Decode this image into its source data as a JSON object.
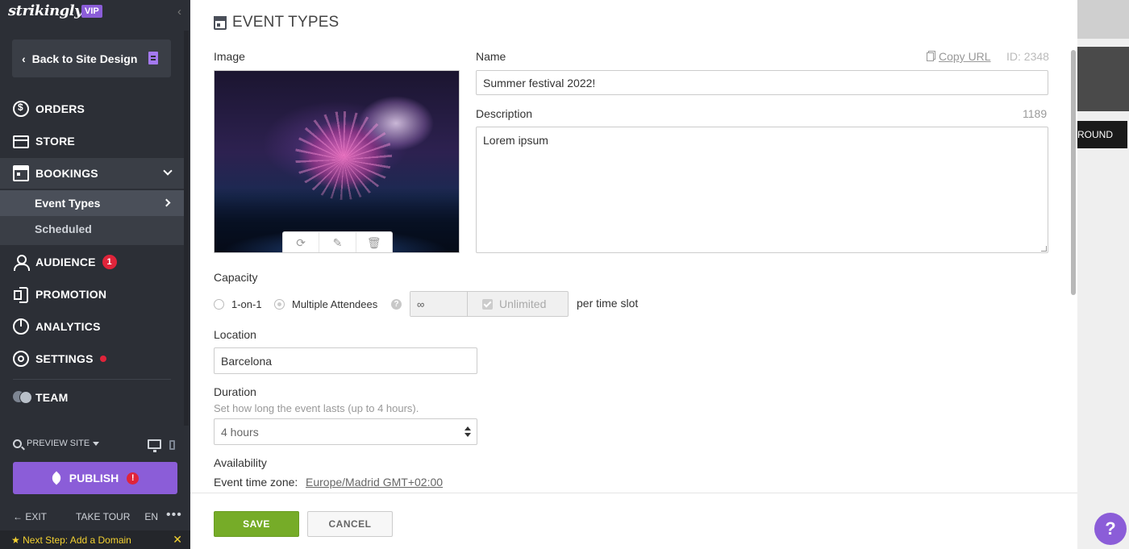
{
  "sidebar": {
    "logo": "strikingly",
    "vip_badge": "VIP",
    "back_label": "Back to Site Design",
    "nav": {
      "orders": "ORDERS",
      "store": "STORE",
      "bookings": "BOOKINGS",
      "audience": "AUDIENCE",
      "audience_badge": "1",
      "promotion": "PROMOTION",
      "analytics": "ANALYTICS",
      "settings": "SETTINGS",
      "team": "TEAM"
    },
    "bookings_sub": {
      "event_types": "Event Types",
      "scheduled": "Scheduled"
    },
    "preview_site": "PREVIEW SITE",
    "publish": "PUBLISH",
    "publish_warning": "!",
    "bottom": {
      "exit": "EXIT",
      "take_tour": "TAKE TOUR",
      "lang": "EN",
      "more": "•••"
    },
    "next_step": "Next Step: Add a Domain"
  },
  "panel": {
    "title": "EVENT TYPES",
    "image_label": "Image",
    "name_label": "Name",
    "copy_url": "Copy URL",
    "id_text": "ID: 2348",
    "name_value": "Summer festival 2022!",
    "description_label": "Description",
    "description_count": "1189",
    "description_value": "Lorem ipsum",
    "capacity_label": "Capacity",
    "capacity_one": "1-on-1",
    "capacity_multi": "Multiple Attendees",
    "capacity_infinity": "∞",
    "capacity_unlimited": "Unlimited",
    "per_time_slot": "per time slot",
    "location_label": "Location",
    "location_value": "Barcelona",
    "duration_label": "Duration",
    "duration_hint": "Set how long the event lasts (up to 4 hours).",
    "duration_value": "4 hours",
    "availability_label": "Availability",
    "timezone_label": "Event time zone:",
    "timezone_value": "Europe/Madrid GMT+02:00",
    "save": "SAVE",
    "cancel": "CANCEL"
  },
  "preview_strip": {
    "button_fragment": "ROUND",
    "help": "?"
  },
  "colors": {
    "sidebar_bg": "#2c2f36",
    "accent_purple": "#8b5dd8",
    "save_green": "#76ac28",
    "alert_red": "#e0243a",
    "next_step_yellow": "#f3d131"
  }
}
